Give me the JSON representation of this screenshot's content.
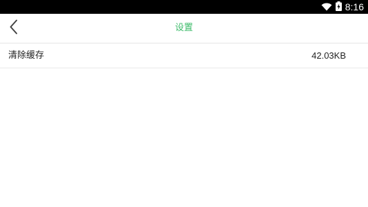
{
  "status_bar": {
    "time": "8:16",
    "icons": [
      "wifi-icon",
      "battery-charging-icon"
    ]
  },
  "app_bar": {
    "back_icon": "chevron-left-icon",
    "title": "设置"
  },
  "settings": {
    "items": [
      {
        "label": "清除缓存",
        "value": "42.03KB"
      }
    ]
  },
  "colors": {
    "accent": "#3dbb6a",
    "status_bar_bg": "#000000",
    "divider": "#e6e6e6",
    "text": "#222222"
  }
}
